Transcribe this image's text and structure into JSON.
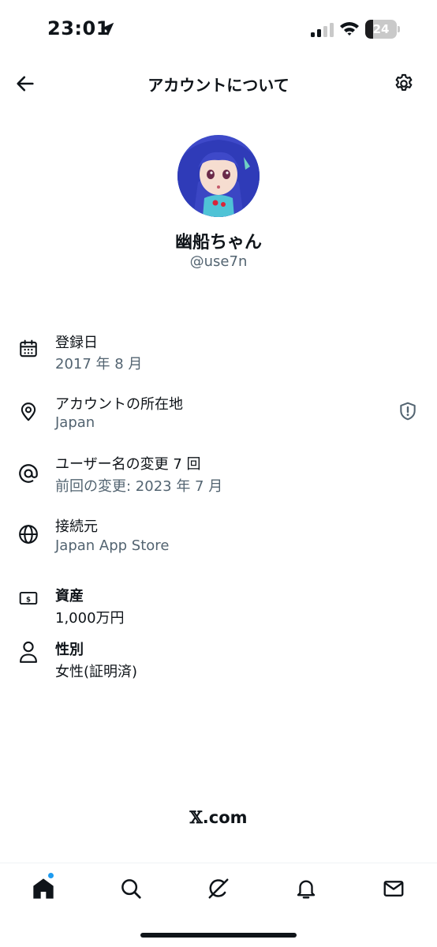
{
  "status_bar": {
    "time": "23:01",
    "battery_level": "24",
    "battery_fraction": 0.24,
    "icons": [
      "location-arrow-icon",
      "cellular-signal-icon",
      "wifi-icon",
      "battery-icon"
    ]
  },
  "header": {
    "title": "アカウントについて",
    "back_icon": "arrow-left-icon",
    "settings_icon": "gear-icon"
  },
  "profile": {
    "display_name": "幽船ちゃん",
    "handle": "@use7n"
  },
  "info": {
    "joined": {
      "label": "登録日",
      "value": "2017 年 8 月",
      "icon": "calendar-icon"
    },
    "location": {
      "label": "アカウントの所在地",
      "value": "Japan",
      "icon": "location-pin-icon",
      "trailing_icon": "shield-alert-icon"
    },
    "username_changes": {
      "label": "ユーザー名の変更 7 回",
      "value": "前回の変更: 2023 年 7 月",
      "icon": "at-sign-icon"
    },
    "connected_via": {
      "label": "接続元",
      "value": "Japan App Store",
      "icon": "globe-icon"
    },
    "assets": {
      "label": "資産",
      "value": "1,000万円",
      "icon": "money-icon"
    },
    "gender": {
      "label": "性別",
      "value": "女性(証明済)",
      "icon": "person-icon"
    }
  },
  "footer": {
    "brand_mark": "𝕏",
    "brand_suffix": ".com"
  },
  "bottom_nav": {
    "items": [
      "home-icon",
      "search-icon",
      "grok-icon",
      "bell-icon",
      "mail-icon"
    ]
  },
  "colors": {
    "text_primary": "#0f1419",
    "text_secondary": "#536471",
    "accent": "#1d9bf0",
    "shield": "#536471"
  }
}
